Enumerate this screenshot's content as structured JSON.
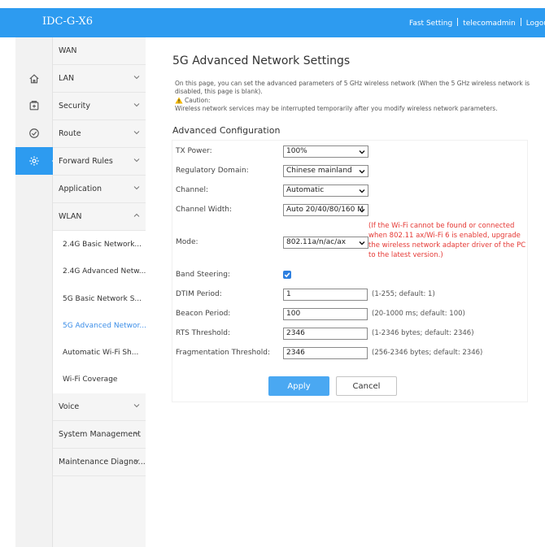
{
  "header": {
    "title": "IDC-G-X6",
    "fast_setting": "Fast Setting",
    "user": "telecomadmin",
    "logout": "Logou"
  },
  "rail": {
    "icons": [
      "home-icon",
      "plus-box-icon",
      "clock-check-icon",
      "gear-icon"
    ],
    "active": "gear-icon"
  },
  "sidebar": {
    "items": [
      {
        "label": "WAN"
      },
      {
        "label": "LAN"
      },
      {
        "label": "Security"
      },
      {
        "label": "Route"
      },
      {
        "label": "Forward Rules"
      },
      {
        "label": "Application"
      },
      {
        "label": "WLAN"
      }
    ],
    "wlan_sub": [
      {
        "label": "2.4G Basic Network..."
      },
      {
        "label": "2.4G Advanced Netw..."
      },
      {
        "label": "5G Basic Network S..."
      },
      {
        "label": "5G Advanced Networ..."
      },
      {
        "label": "Automatic Wi-Fi Sh..."
      },
      {
        "label": "Wi-Fi Coverage"
      }
    ],
    "bottom_items": [
      {
        "label": "Voice"
      },
      {
        "label": "System Management"
      },
      {
        "label": "Maintenance Diagno..."
      }
    ]
  },
  "main": {
    "title": "5G Advanced Network Settings",
    "description": "On this page, you can set the advanced parameters of 5 GHz wireless network (When the 5 GHz wireless network is disabled, this page is blank).",
    "caution_label": "Caution:",
    "caution_text": "Wireless network services may be interrupted temporarily after you modify wireless network parameters.",
    "section_title": "Advanced Configuration",
    "fields": {
      "tx_power": {
        "label": "TX Power:",
        "value": "100%"
      },
      "regulatory_domain": {
        "label": "Regulatory Domain:",
        "value": "Chinese mainland"
      },
      "channel": {
        "label": "Channel:",
        "value": "Automatic"
      },
      "channel_width": {
        "label": "Channel Width:",
        "value": "Auto 20/40/80/160 M"
      },
      "mode": {
        "label": "Mode:",
        "value": "802.11a/n/ac/ax",
        "note": "(If the Wi-Fi cannot be found or connected when 802.11 ax/Wi-Fi 6 is enabled, upgrade the wireless network adapter driver of the PC to the latest version.)"
      },
      "band_steering": {
        "label": "Band Steering:",
        "checked": true
      },
      "dtim_period": {
        "label": "DTIM Period:",
        "value": "1",
        "hint": "(1-255; default: 1)"
      },
      "beacon_period": {
        "label": "Beacon Period:",
        "value": "100",
        "hint": "(20-1000 ms; default: 100)"
      },
      "rts_threshold": {
        "label": "RTS Threshold:",
        "value": "2346",
        "hint": "(1-2346 bytes; default: 2346)"
      },
      "fragmentation_threshold": {
        "label": "Fragmentation Threshold:",
        "value": "2346",
        "hint": "(256-2346 bytes; default: 2346)"
      }
    },
    "apply_label": "Apply",
    "cancel_label": "Cancel"
  },
  "colors": {
    "accent": "#2d9bf0",
    "warning_text": "#e53935",
    "apply_button": "#4aa8f2"
  }
}
